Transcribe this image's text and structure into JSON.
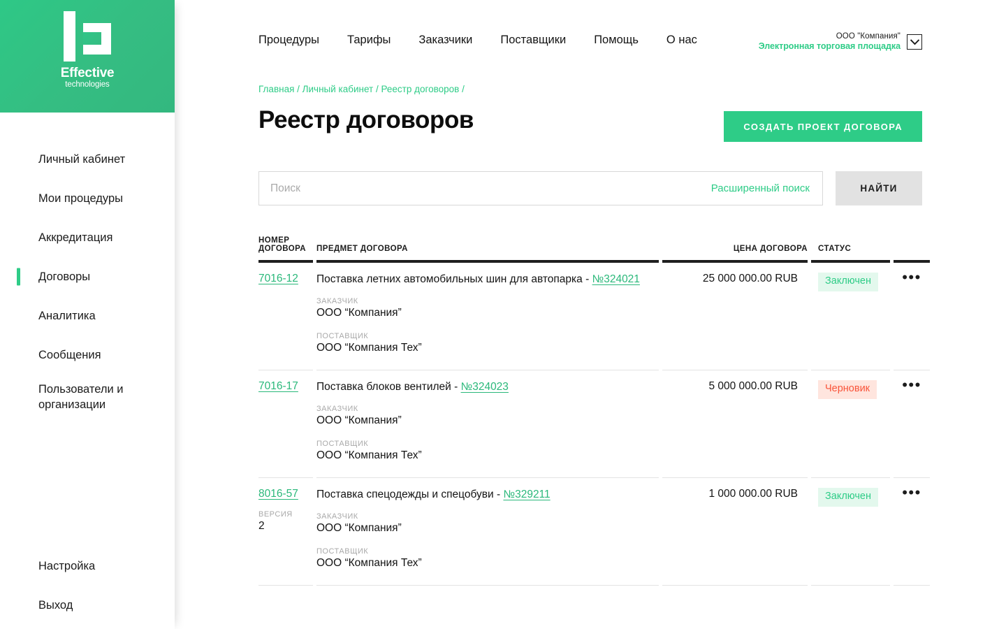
{
  "brand": {
    "logo_word": "Effective",
    "logo_sub": "technologies",
    "logo_icon": "effective-technologies-logo",
    "accent_green": "#2ecc87",
    "accent_red": "#f9543a"
  },
  "sidebar": {
    "primary_items": [
      {
        "label": "Личный кабинет",
        "active": false
      },
      {
        "label": "Мои процедуры",
        "active": false
      },
      {
        "label": "Аккредитация",
        "active": false
      },
      {
        "label": "Договоры",
        "active": true
      },
      {
        "label": "Аналитика",
        "active": false
      },
      {
        "label": "Сообщения",
        "active": false
      },
      {
        "label": "Пользователи и организации",
        "active": false
      }
    ],
    "bottom_items": [
      {
        "label": "Настройка"
      },
      {
        "label": "Выход"
      }
    ]
  },
  "topnav": {
    "items": [
      {
        "label": "Процедуры"
      },
      {
        "label": "Тарифы"
      },
      {
        "label": "Заказчики"
      },
      {
        "label": "Поставщики"
      },
      {
        "label": "Помощь"
      },
      {
        "label": "О нас"
      }
    ]
  },
  "account": {
    "company": "ООО \"Компания\"",
    "subtitle": "Электронная торговая площадка",
    "caret_icon": "chevron-down-icon"
  },
  "breadcrumb": {
    "items": [
      "Главная",
      "Личный кабинет",
      "Реестр договоров"
    ],
    "separator": "/",
    "trailing": "/"
  },
  "page": {
    "title": "Реестр договоров",
    "create_button": "СОЗДАТЬ ПРОЕКТ ДОГОВОРА"
  },
  "search": {
    "placeholder": "Поиск",
    "value": "",
    "advanced_label": "Расширенный поиск",
    "submit_label": "НАЙТИ"
  },
  "table": {
    "headers": {
      "number_line1": "НОМЕР",
      "number_line2": "ДОГОВОРА",
      "subject": "ПРЕДМЕТ ДОГОВОРА",
      "price": "ЦЕНА ДОГОВОРА",
      "status": "СТАТУС"
    },
    "labels": {
      "customer": "ЗАКАЗЧИК",
      "supplier": "ПОСТАВЩИК",
      "version": "ВЕРСИЯ"
    },
    "menu_icon": "more-options-icon",
    "rows": [
      {
        "number": "7016-12",
        "version": null,
        "subject_text": "Поставка летних автомобильных шин для автопарка - ",
        "subject_link": "№324021",
        "customer": "ООО “Компания”",
        "supplier": "ООО “Компания Тех”",
        "price": "25 000 000.00 RUB",
        "status": "Заключен",
        "status_kind": "green"
      },
      {
        "number": "7016-17",
        "version": null,
        "subject_text": "Поставка блоков вентилей  - ",
        "subject_link": "№324023",
        "customer": "ООО “Компания”",
        "supplier": "ООО “Компания Тех”",
        "price": "5 000 000.00 RUB",
        "status": "Черновик",
        "status_kind": "red"
      },
      {
        "number": "8016-57",
        "version": "2",
        "subject_text": "Поставка спецодежды и спецобуви - ",
        "subject_link": "№329211",
        "customer": "ООО “Компания”",
        "supplier": "ООО “Компания Тех”",
        "price": "1 000 000.00 RUB",
        "status": "Заключен",
        "status_kind": "green"
      }
    ]
  }
}
